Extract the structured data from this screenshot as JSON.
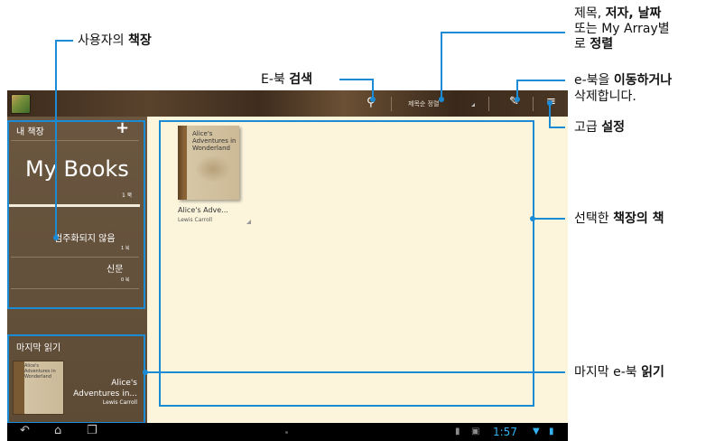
{
  "topbar": {
    "sort_label": "제목순 정렬",
    "icons": {
      "search": "search-icon",
      "edit": "pencil-icon",
      "menu": "menu-icon"
    }
  },
  "sidebar": {
    "shelf_header": "내 책장",
    "add_symbol": "+",
    "my_books_title": "My Books",
    "my_books_count": "1 북",
    "items": [
      {
        "label": "범주화되지 않음",
        "count": "1 북"
      },
      {
        "label": "신문",
        "count": "0 북"
      }
    ],
    "recent_header": "마지막 읽기",
    "recent_book": {
      "cover_title": "Alice's Adventures in Wonderland",
      "title": "Alice's Adventures in...",
      "author": "Lewis Carroll"
    }
  },
  "main": {
    "book": {
      "cover_title": "Alice's Adventures in Wonderland",
      "title": "Alice's Adve...",
      "author": "Lewis Carroll"
    }
  },
  "status_bar": {
    "time": "1:57"
  },
  "callouts": {
    "my_shelf": {
      "normal": "사용자의 ",
      "bold": "책장"
    },
    "search": {
      "normal": "E-북 ",
      "bold": "검색"
    },
    "sort": {
      "line1_normal": "제목, ",
      "line1_bold": "저자, 날짜",
      "line2": "또는 My Array별",
      "line3_normal": "로 ",
      "line3_bold": "정렬"
    },
    "move_delete": {
      "line1_normal": "e-북을 ",
      "line1_bold": "이동하거나",
      "line2": "삭제합니다."
    },
    "advanced": {
      "normal": "고급 ",
      "bold": "설정"
    },
    "selected": {
      "normal": "선택한 ",
      "bold": "책장의 책"
    },
    "last_read": {
      "normal": "마지막 e-북 ",
      "bold": "읽기"
    }
  },
  "colors": {
    "callout_blue": "#1b8bd6",
    "shelf_brown": "#5d4b36",
    "content_bg": "#fcf5dc",
    "clock_blue": "#35b3f0"
  }
}
